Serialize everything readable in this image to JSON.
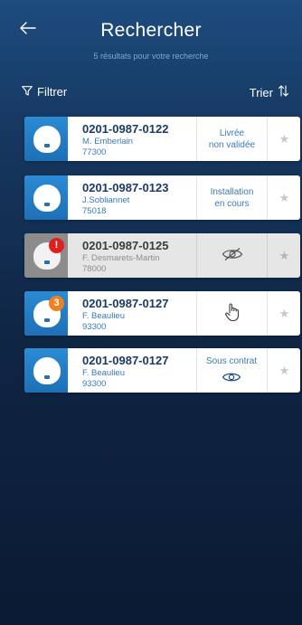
{
  "header": {
    "back_icon": "arrow-left-icon",
    "title": "Rechercher",
    "subtitle": "5 résultats pour votre recherche"
  },
  "toolbar": {
    "filter_label": "Filtrer",
    "filter_icon": "funnel-icon",
    "sort_label": "Trier",
    "sort_icon": "sort-arrows-icon"
  },
  "colors": {
    "card_accent": "#2b8bd4",
    "badge_alert": "#e0201f",
    "badge_count": "#f07f1f",
    "link_text": "#3a79b8"
  },
  "results": [
    {
      "ref": "0201-0987-0122",
      "name": "M. Emberlain",
      "zip": "77300",
      "status_lines": [
        "Livrée",
        "non validée"
      ],
      "status_icon": "",
      "badge": "",
      "disabled": false
    },
    {
      "ref": "0201-0987-0123",
      "name": "J.Sobliannet",
      "zip": "75018",
      "status_lines": [
        "Installation",
        "en cours"
      ],
      "status_icon": "",
      "badge": "",
      "disabled": false
    },
    {
      "ref": "0201-0987-0125",
      "name": "F. Desmarets-Martin",
      "zip": "78000",
      "status_lines": [],
      "status_icon": "eye-slash-icon",
      "badge": "!",
      "disabled": true
    },
    {
      "ref": "0201-0987-0127",
      "name": "F. Beaulieu",
      "zip": "93300",
      "status_lines": [],
      "status_icon": "hand-pointer-icon",
      "badge": "3",
      "disabled": false
    },
    {
      "ref": "0201-0987-0127",
      "name": "F. Beaulieu",
      "zip": "93300",
      "status_lines": [
        "Sous contrat"
      ],
      "status_icon": "eye-icon",
      "badge": "",
      "disabled": false
    }
  ]
}
